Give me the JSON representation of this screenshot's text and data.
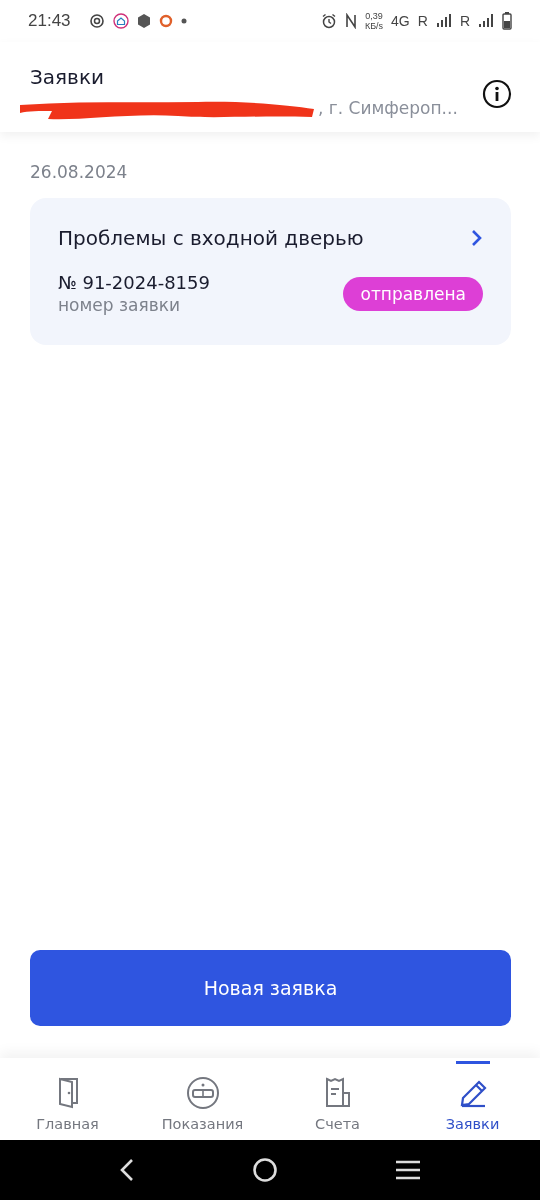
{
  "status_bar": {
    "time": "21:43",
    "speed": "0,39",
    "speed_unit": "КБ/s",
    "network": "4G",
    "roaming_1": "R",
    "roaming_2": "R"
  },
  "header": {
    "title": "Заявки",
    "subtitle": ", г. Симфероп..."
  },
  "date": "26.08.2024",
  "requests": [
    {
      "title": "Проблемы с входной дверью",
      "number": "№ 91-2024-8159",
      "number_label": "номер заявки",
      "status": "отправлена",
      "color": "#dd3fd6"
    }
  ],
  "new_button": "Новая заявка",
  "nav": [
    {
      "label": "Главная",
      "selected": false
    },
    {
      "label": "Показания",
      "selected": false
    },
    {
      "label": "Счета",
      "selected": false
    },
    {
      "label": "Заявки",
      "selected": true
    }
  ]
}
